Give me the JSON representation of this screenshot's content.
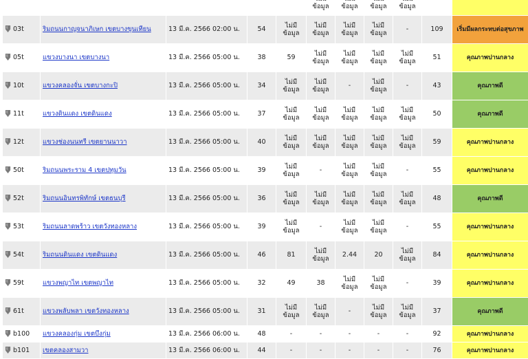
{
  "colors": {
    "good": "#99cc66",
    "moderate": "#ffff66",
    "unhealthy_sensitive": "#f2a23c",
    "link": "#1a35c8"
  },
  "no_data_line1": "ไม่มี",
  "no_data_line2": "ข้อมูล",
  "rows": [
    {
      "station": "",
      "area": "",
      "time": "",
      "aqi": "",
      "v1": "",
      "v2": "nd",
      "v3": "nd",
      "v4": "nd",
      "v5": "nd",
      "index": "",
      "quality": "",
      "level": "moderate",
      "height": 36
    },
    {
      "station": "03t",
      "area": "ริมถนนกาญจนาภิเษก เขตบางขุนเทียน",
      "time": "13 มี.ค. 2566 02:00 น.",
      "aqi": "54",
      "v1": "nd",
      "v2": "nd",
      "v3": "nd",
      "v4": "nd",
      "v5": "-",
      "index": "109",
      "quality": "เริ่มมีผลกระทบต่อสุขภาพ",
      "level": "unhealthy_sensitive",
      "height": 41
    },
    {
      "station": "05t",
      "area": "แขวงบางนา เขตบางนา",
      "time": "13 มี.ค. 2566 05:00 น.",
      "aqi": "38",
      "v1": "59",
      "v2": "nd",
      "v3": "nd",
      "v4": "nd",
      "v5": "nd",
      "index": "51",
      "quality": "คุณภาพปานกลาง",
      "level": "moderate",
      "height": 41
    },
    {
      "station": "10t",
      "area": "แขวงคลองจั่น เขตบางกะปิ",
      "time": "13 มี.ค. 2566 05:00 น.",
      "aqi": "34",
      "v1": "nd",
      "v2": "nd",
      "v3": "-",
      "v4": "nd",
      "v5": "-",
      "index": "43",
      "quality": "คุณภาพดี",
      "level": "good",
      "height": 41
    },
    {
      "station": "11t",
      "area": "แขวงดินแดง เขตดินแดง",
      "time": "13 มี.ค. 2566 05:00 น.",
      "aqi": "37",
      "v1": "nd",
      "v2": "nd",
      "v3": "nd",
      "v4": "nd",
      "v5": "nd",
      "index": "50",
      "quality": "คุณภาพดี",
      "level": "good",
      "height": 41
    },
    {
      "station": "12t",
      "area": "แขวงช่องนนทรี เขตยานนาวา",
      "time": "13 มี.ค. 2566 05:00 น.",
      "aqi": "40",
      "v1": "nd",
      "v2": "nd",
      "v3": "nd",
      "v4": "nd",
      "v5": "nd",
      "index": "59",
      "quality": "คุณภาพปานกลาง",
      "level": "moderate",
      "height": 41
    },
    {
      "station": "50t",
      "area": "ริมถนนพระราม 4 เขตปทุมวัน",
      "time": "13 มี.ค. 2566 05:00 น.",
      "aqi": "39",
      "v1": "nd",
      "v2": "-",
      "v3": "nd",
      "v4": "nd",
      "v5": "-",
      "index": "55",
      "quality": "คุณภาพปานกลาง",
      "level": "moderate",
      "height": 41
    },
    {
      "station": "52t",
      "area": "ริมถนนอินทรพิทักษ์ เขตธนบุรี",
      "time": "13 มี.ค. 2566 05:00 น.",
      "aqi": "36",
      "v1": "nd",
      "v2": "nd",
      "v3": "nd",
      "v4": "nd",
      "v5": "nd",
      "index": "48",
      "quality": "คุณภาพดี",
      "level": "good",
      "height": 41
    },
    {
      "station": "53t",
      "area": "ริมถนนลาดพร้าว เขตวังทองหลาง",
      "time": "13 มี.ค. 2566 05:00 น.",
      "aqi": "39",
      "v1": "nd",
      "v2": "-",
      "v3": "nd",
      "v4": "nd",
      "v5": "-",
      "index": "55",
      "quality": "คุณภาพปานกลาง",
      "level": "moderate",
      "height": 41
    },
    {
      "station": "54t",
      "area": "ริมถนนดินแดง เขตดินแดง",
      "time": "13 มี.ค. 2566 05:00 น.",
      "aqi": "46",
      "v1": "81",
      "v2": "nd",
      "v3": "2.44",
      "v4": "20",
      "v5": "nd",
      "index": "84",
      "quality": "คุณภาพปานกลาง",
      "level": "moderate",
      "height": 41
    },
    {
      "station": "59t",
      "area": "แขวงพญาไท เขตพญาไท",
      "time": "13 มี.ค. 2566 05:00 น.",
      "aqi": "32",
      "v1": "49",
      "v2": "38",
      "v3": "nd",
      "v4": "nd",
      "v5": "-",
      "index": "39",
      "quality": "คุณภาพปานกลาง",
      "level": "moderate",
      "height": 41
    },
    {
      "station": "61t",
      "area": "แขวงพลับพลา เขตวังทองหลาง",
      "time": "13 มี.ค. 2566 05:00 น.",
      "aqi": "31",
      "v1": "nd",
      "v2": "nd",
      "v3": "-",
      "v4": "nd",
      "v5": "nd",
      "index": "37",
      "quality": "คุณภาพดี",
      "level": "good",
      "height": 41
    },
    {
      "station": "b100",
      "area": "แขวงคลองกุ่ม เขตบึงกุ่ม",
      "time": "13 มี.ค. 2566 06:00 น.",
      "aqi": "48",
      "v1": "-",
      "v2": "-",
      "v3": "-",
      "v4": "-",
      "v5": "-",
      "index": "92",
      "quality": "คุณภาพปานกลาง",
      "level": "moderate",
      "height": 24
    },
    {
      "station": "b101",
      "area": "เขตคลองสามวา",
      "time": "13 มี.ค. 2566 06:00 น.",
      "aqi": "44",
      "v1": "-",
      "v2": "-",
      "v3": "-",
      "v4": "-",
      "v5": "-",
      "index": "76",
      "quality": "คุณภาพปานกลาง",
      "level": "moderate",
      "height": 24
    }
  ]
}
